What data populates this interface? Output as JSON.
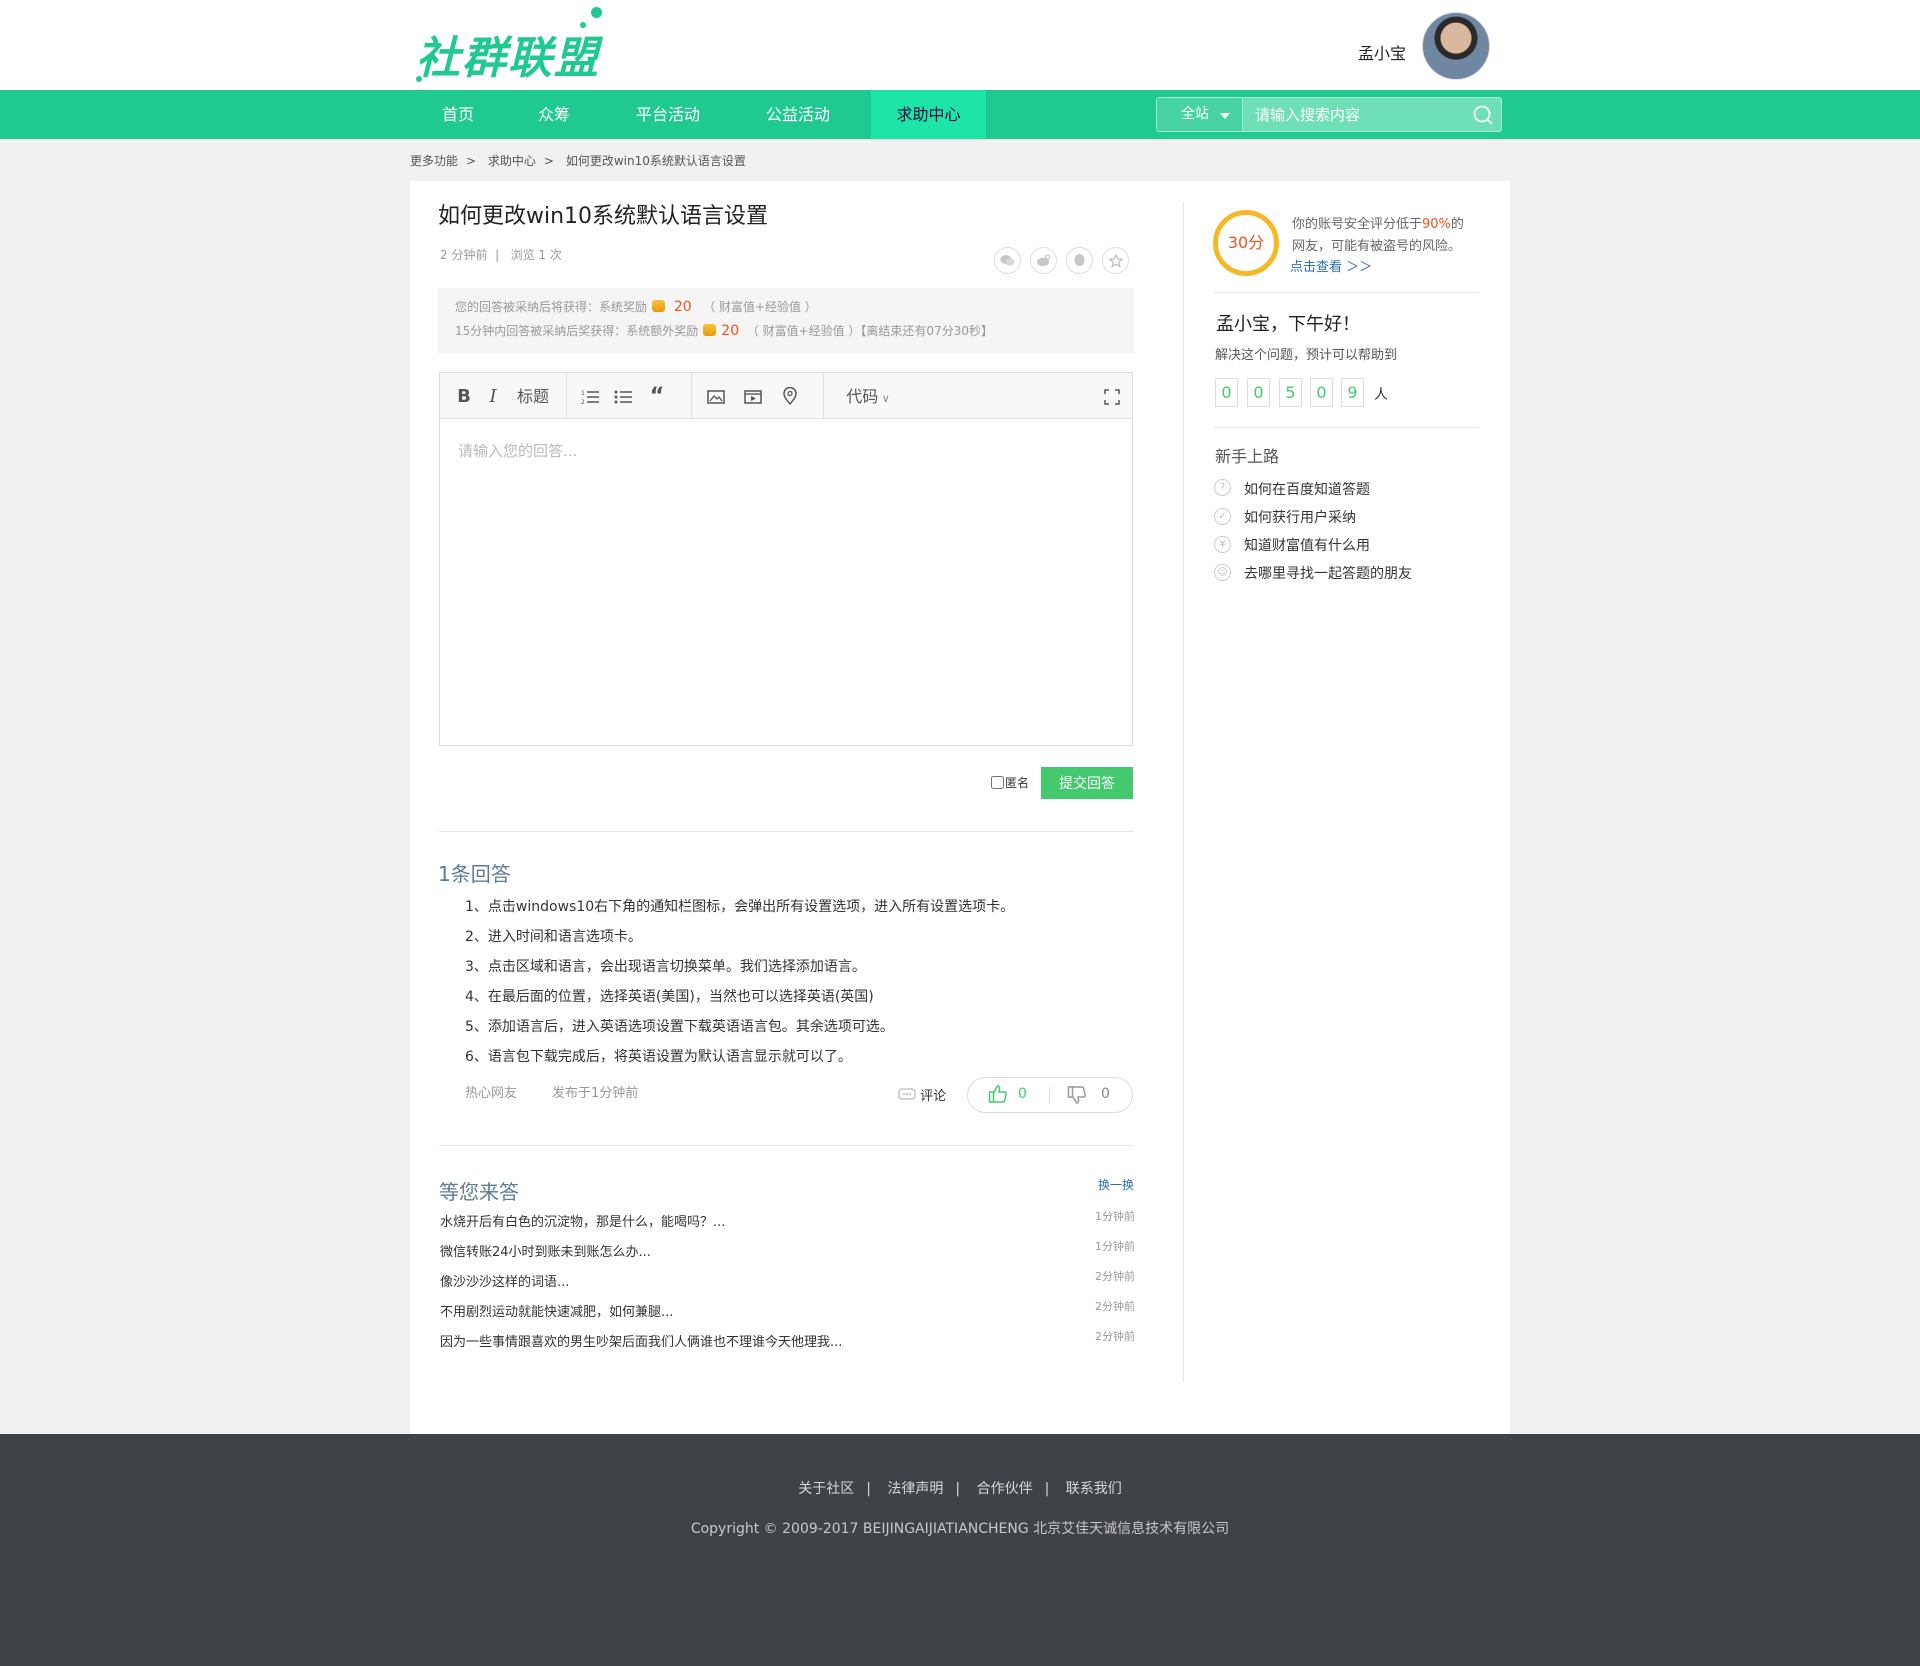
{
  "brand": {
    "logo_text": "社群联盟",
    "accent": "#20c98f"
  },
  "user": {
    "name": "孟小宝"
  },
  "nav": {
    "items": [
      "首页",
      "众筹",
      "平台活动",
      "公益活动",
      "求助中心"
    ],
    "active": "求助中心"
  },
  "search": {
    "scope": "全站",
    "placeholder": "请输入搜索内容"
  },
  "breadcrumb": [
    "更多功能",
    "求助中心",
    "如何更改win10系统默认语言设置"
  ],
  "question": {
    "title": "如何更改win10系统默认语言设置",
    "time": "2 分钟前",
    "views": "浏览 1 次",
    "share_icons": [
      "wechat-icon",
      "weibo-icon",
      "qq-icon",
      "favorite-star-icon"
    ]
  },
  "reward": {
    "line1_prefix": "您的回答被采纳后将获得：系统奖励",
    "line1_value": "20",
    "line1_suffix": "（ 财富值+经验值 ）",
    "line2_prefix": "15分钟内回答被采纳后奖获得：系统额外奖励",
    "line2_value": "20",
    "line2_suffix": "（ 财富值+经验值 ）【离结束还有07分30秒】"
  },
  "editor": {
    "toolbar": {
      "bold": "B",
      "italic": "I",
      "heading": "标题",
      "code": "代码"
    },
    "placeholder": "请输入您的回答...",
    "anonymous_label": "匿名",
    "submit_label": "提交回答"
  },
  "answers": {
    "count_label": "1条回答",
    "items": [
      {
        "steps": [
          "1、点击windows10右下角的通知栏图标，会弹出所有设置选项，进入所有设置选项卡。",
          "2、进入时间和语言选项卡。",
          "3、点击区域和语言，会出现语言切换菜单。我们选择添加语言。",
          "4、在最后面的位置，选择英语(美国)，当然也可以选择英语(英国)",
          "5、添加语言后，进入英语选项设置下载英语语言包。其余选项可选。",
          "6、语言包下载完成后，将英语设置为默认语言显示就可以了。"
        ],
        "author": "热心网友",
        "time": "发布于1分钟前",
        "comment_label": "评论",
        "likes": "0",
        "dislikes": "0"
      }
    ]
  },
  "waiting": {
    "title": "等您来答",
    "refresh": "换一换",
    "items": [
      {
        "q": "水烧开后有白色的沉淀物，那是什么，能喝吗？...",
        "t": "1分钟前"
      },
      {
        "q": "微信转账24小时到账未到账怎么办...",
        "t": "1分钟前"
      },
      {
        "q": "像沙沙沙这样的词语...",
        "t": "2分钟前"
      },
      {
        "q": "不用剧烈运动就能快速减肥，如何兼腿...",
        "t": "2分钟前"
      },
      {
        "q": "因为一些事情跟喜欢的男生吵架后面我们人俩谁也不理谁今天他理我...",
        "t": "2分钟前"
      }
    ]
  },
  "sidebar": {
    "score": "30分",
    "security_line1_prefix": "你的账号安全评分低于",
    "security_percent": "90%",
    "security_line1_suffix": "的",
    "security_line2": "网友，可能有被盗号的风险。",
    "security_link": "点击查看 ＞＞",
    "greeting": "孟小宝，下午好！",
    "help_text": "解决这个问题，预计可以帮助到",
    "help_digits": [
      "0",
      "0",
      "5",
      "0",
      "9"
    ],
    "help_unit": "人",
    "guide_title": "新手上路",
    "guide_items": [
      {
        "icon": "question-icon",
        "label": "如何在百度知道答题"
      },
      {
        "icon": "check-icon",
        "label": "如何获行用户采纳"
      },
      {
        "icon": "yen-icon",
        "label": "知道财富值有什么用"
      },
      {
        "icon": "friends-icon",
        "label": "去哪里寻找一起答题的朋友"
      }
    ]
  },
  "footer": {
    "links": [
      "关于社区",
      "法律声明",
      "合作伙伴",
      "联系我们"
    ],
    "copyright": "Copyright © 2009-2017 BEIJINGAIJIATIANCHENG 北京艾佳天诚信息技术有限公司"
  }
}
